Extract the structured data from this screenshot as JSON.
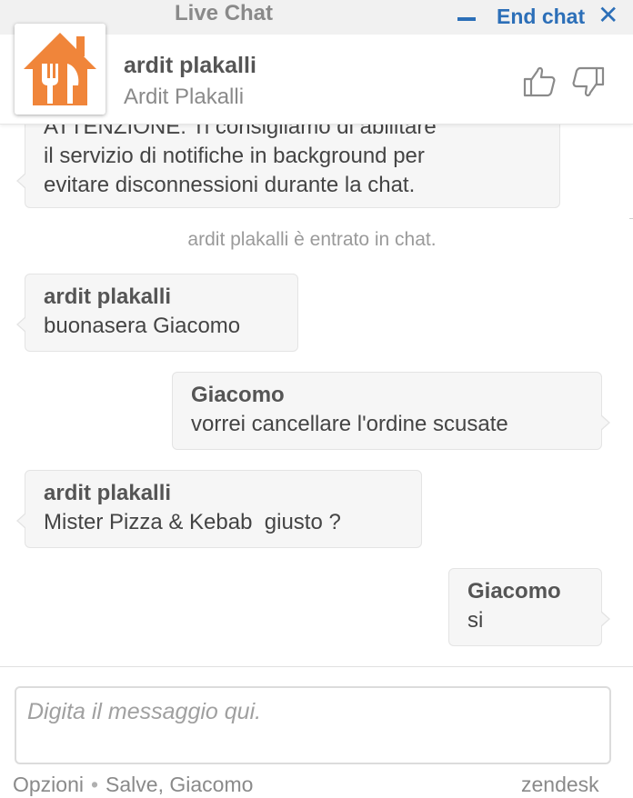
{
  "header": {
    "title": "Live Chat",
    "end_chat_label": "End chat",
    "close_glyph": "✕",
    "accent_color": "#2c6fb8"
  },
  "agent": {
    "name": "ardit plakalli",
    "subtitle": "Ardit Plakalli",
    "logo_color": "#f0853a",
    "logo_icon": "house-fork-knife-logo",
    "rating_icons": [
      "thumbs-up-icon",
      "thumbs-down-icon"
    ]
  },
  "messages": {
    "notice_lines": [
      "ATTENZIONE: Ti consigliamo di abilitare",
      "il servizio di notifiche in background per",
      "evitare disconnessioni durante la chat."
    ],
    "system_text": "ardit plakalli è entrato in chat.",
    "items": [
      {
        "sender": "ardit plakalli",
        "text": "buonasera Giacomo"
      },
      {
        "sender": "Giacomo",
        "text": "vorrei cancellare l'ordine scusate"
      },
      {
        "sender": "ardit plakalli",
        "text": "Mister Pizza & Kebab  giusto ?"
      },
      {
        "sender": "Giacomo",
        "text": "si"
      }
    ]
  },
  "composer": {
    "placeholder": "Digita il messaggio qui.",
    "value": ""
  },
  "footer": {
    "options_label": "Opzioni",
    "greeting": "Salve, Giacomo",
    "brand": "zendesk"
  }
}
